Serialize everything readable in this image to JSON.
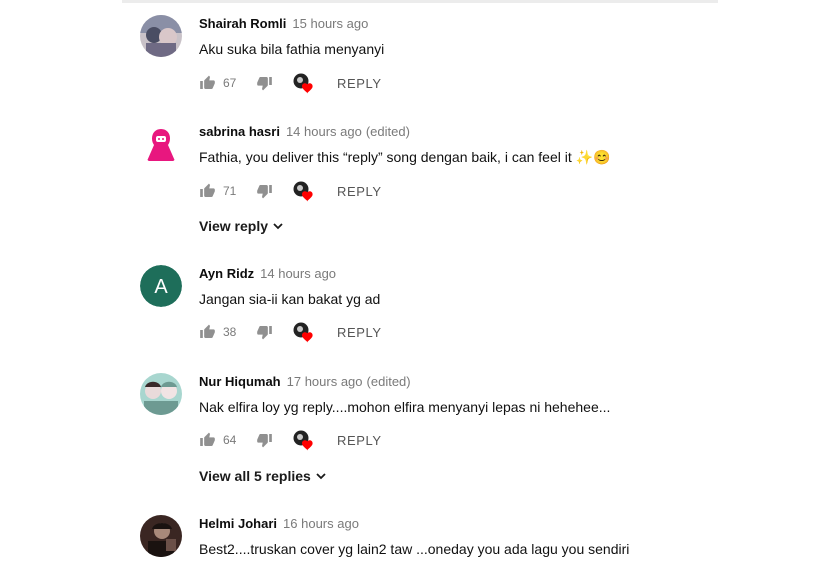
{
  "comments": [
    {
      "author": "Shairah Romli",
      "time": "15 hours ago",
      "edited": "",
      "text": "Aku suka bila fathia menyanyi",
      "likes": "67",
      "reply_label": "REPLY",
      "avatar": {
        "type": "photo",
        "colors": [
          "#8a8fa6",
          "#d9c7c9",
          "#4a4d63"
        ]
      }
    },
    {
      "author": "sabrina hasri",
      "time": "14 hours ago",
      "edited": "(edited)",
      "text": "Fathia, you deliver this “reply” song dengan baik, i can feel it ✨😊",
      "likes": "71",
      "reply_label": "REPLY",
      "view_replies": "View reply",
      "avatar": {
        "type": "hijab-figure",
        "colors": [
          "#e8177f",
          "#ffffff"
        ]
      }
    },
    {
      "author": "Ayn Ridz",
      "time": "14 hours ago",
      "edited": "",
      "text": "Jangan sia-ii kan bakat yg ad",
      "likes": "38",
      "reply_label": "REPLY",
      "avatar": {
        "type": "letter",
        "letter": "A",
        "colors": [
          "#1e6e5a",
          "#ffffff"
        ]
      }
    },
    {
      "author": "Nur Hiqumah",
      "time": "17 hours ago",
      "edited": "(edited)",
      "text": "Nak elfira loy yg reply....mohon elfira menyanyi lepas ni hehehee...",
      "likes": "64",
      "reply_label": "REPLY",
      "view_replies": "View all 5 replies",
      "avatar": {
        "type": "photo",
        "colors": [
          "#a8d6cf",
          "#e9dada",
          "#6d9a92"
        ]
      }
    },
    {
      "author": "Helmi Johari",
      "time": "16 hours ago",
      "edited": "",
      "text": "Best2....truskan cover yg lain2 taw ...oneday you ada lagu you sendiri",
      "avatar": {
        "type": "photo",
        "colors": [
          "#3a2622",
          "#a8897a",
          "#1a1210"
        ]
      }
    }
  ],
  "icons": {
    "like": "thumb-up-icon",
    "dislike": "thumb-down-icon",
    "creator_heart": "creator-heart-icon",
    "expand": "chevron-down-icon"
  },
  "colors": {
    "icon_gray": "#909090",
    "heart_red": "#ff0000",
    "meta_gray": "#7a7a7a"
  }
}
